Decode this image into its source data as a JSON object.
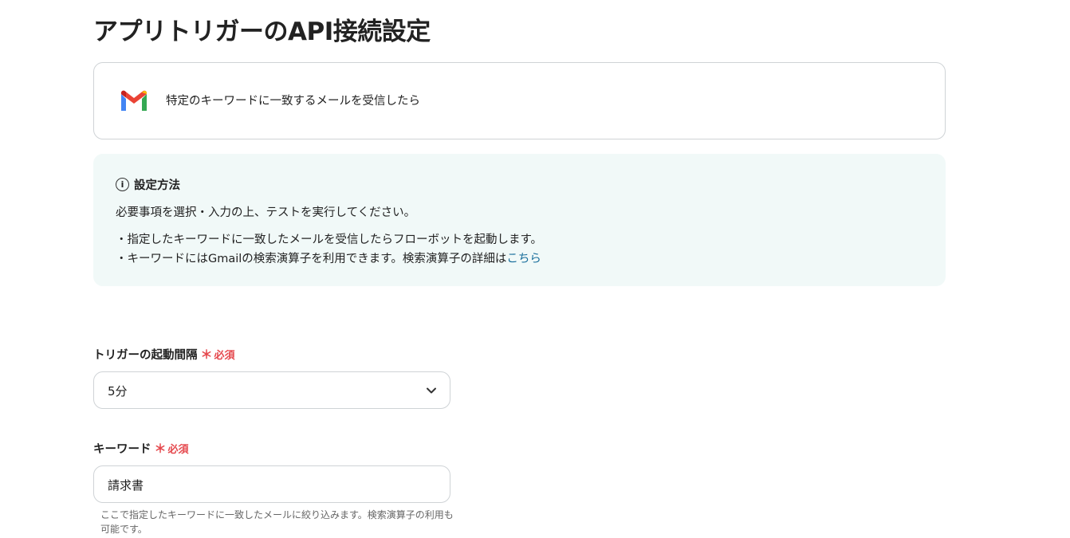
{
  "page": {
    "title": "アプリトリガーのAPI接続設定"
  },
  "trigger": {
    "icon": "gmail-icon",
    "label": "特定のキーワードに一致するメールを受信したら"
  },
  "info": {
    "icon": "info-icon",
    "heading": "設定方法",
    "line1": "必要事項を選択・入力の上、テストを実行してください。",
    "line2": "・指定したキーワードに一致したメールを受信したらフローボットを起動します。",
    "line3_prefix": "・キーワードにはGmailの検索演算子を利用できます。検索演算子の詳細は",
    "line3_link": "こちら"
  },
  "fields": {
    "interval": {
      "label": "トリガーの起動間隔",
      "required_mark": "＊",
      "required_label": "必須",
      "value": "5分"
    },
    "keyword": {
      "label": "キーワード",
      "required_mark": "＊",
      "required_label": "必須",
      "value": "請求書",
      "help": "ここで指定したキーワードに一致したメールに絞り込みます。検索演算子の利用も可能です。"
    }
  },
  "colors": {
    "required": "#e5484d",
    "link": "#1a6f9c",
    "info_bg": "#f1f9f8",
    "border": "#cfd3d6"
  }
}
